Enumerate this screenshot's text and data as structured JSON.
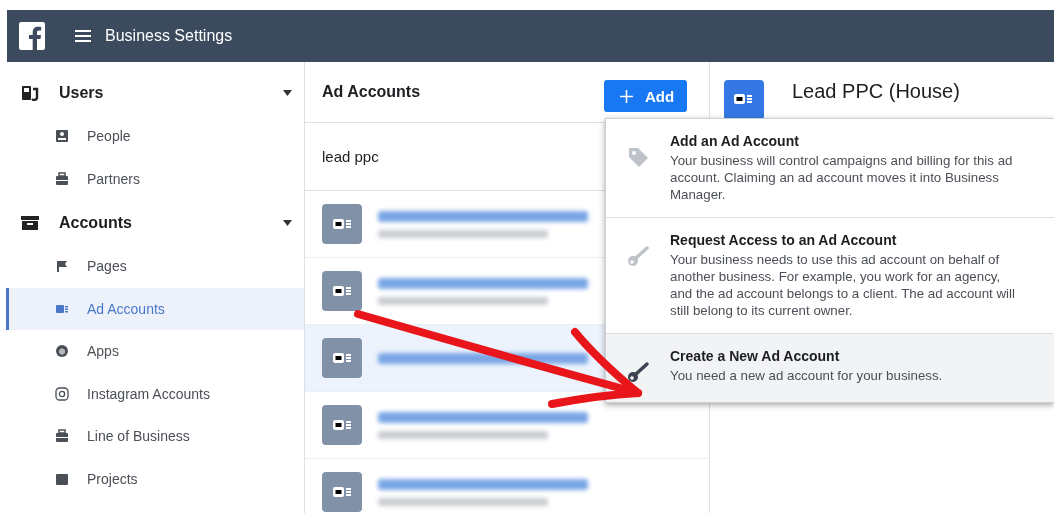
{
  "header": {
    "title": "Business Settings"
  },
  "sidebar": {
    "sections": [
      {
        "label": "Users",
        "expanded": true,
        "items": [
          {
            "label": "People",
            "selected": false
          },
          {
            "label": "Partners",
            "selected": false
          }
        ]
      },
      {
        "label": "Accounts",
        "expanded": true,
        "items": [
          {
            "label": "Pages",
            "selected": false
          },
          {
            "label": "Ad Accounts",
            "selected": true
          },
          {
            "label": "Apps",
            "selected": false
          },
          {
            "label": "Instagram Accounts",
            "selected": false
          },
          {
            "label": "Line of Business",
            "selected": false
          },
          {
            "label": "Projects",
            "selected": false
          }
        ]
      }
    ]
  },
  "list_panel": {
    "title": "Ad Accounts",
    "add_button": "Add",
    "search": {
      "value": "lead ppc"
    },
    "rows": [
      {
        "selected": false,
        "kind": "two-line"
      },
      {
        "selected": false,
        "kind": "two-line"
      },
      {
        "selected": true,
        "kind": "one-line"
      },
      {
        "selected": false,
        "kind": "two-line"
      },
      {
        "selected": false,
        "kind": "two-line"
      }
    ]
  },
  "detail": {
    "title": "Lead PPC (House)"
  },
  "add_menu": {
    "items": [
      {
        "kind": "tag",
        "title": "Add an Ad Account",
        "description": "Your business will control campaigns and billing for this ad account. Claiming an ad account moves it into Business Manager.",
        "selected": false
      },
      {
        "kind": "key",
        "title": "Request Access to an Ad Account",
        "description": "Your business needs to use this ad account on behalf of another business. For example, you work for an agency, and the ad account belongs to a client. The ad account will still belong to its current owner.",
        "selected": false
      },
      {
        "kind": "key",
        "title": "Create a New Ad Account",
        "description": "You need a new ad account for your business.",
        "selected": true
      }
    ]
  }
}
